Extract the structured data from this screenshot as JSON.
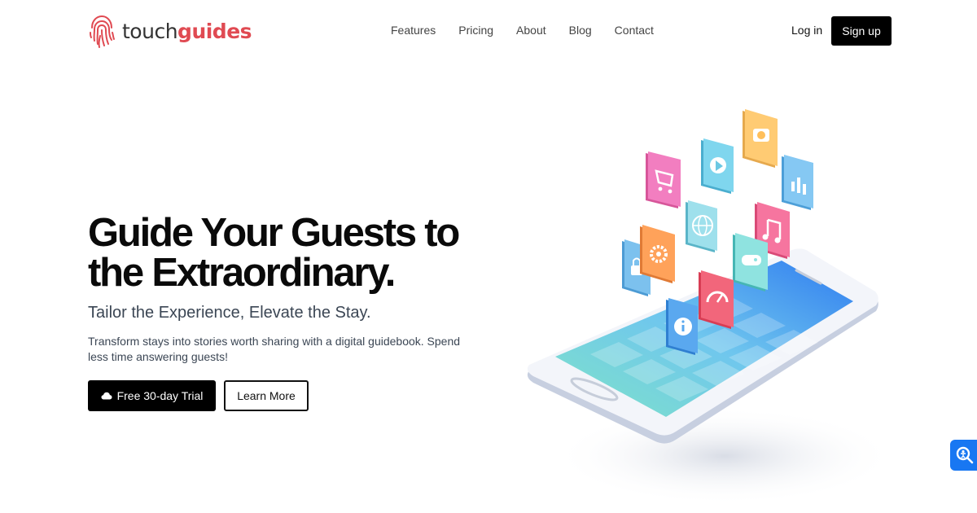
{
  "brand": {
    "name_part1": "touch",
    "name_part2": "guides",
    "brand_color": "#e04a52",
    "logo_icon": "fingerprint-icon"
  },
  "nav": {
    "links": [
      "Features",
      "Pricing",
      "About",
      "Blog",
      "Contact"
    ],
    "login_label": "Log in",
    "signup_label": "Sign up"
  },
  "hero": {
    "title": "Guide Your Guests to the Extraordinary.",
    "subtitle": "Tailor the Experience, Elevate the Stay.",
    "description": "Transform stays into stories worth sharing with a digital guidebook. Spend less time answering guests!",
    "primary_button": {
      "label": "Free 30-day Trial",
      "icon": "cloud-icon"
    },
    "secondary_button": {
      "label": "Learn More"
    }
  },
  "illustration": {
    "subject": "isometric smartphone with floating app icons",
    "app_icons": [
      "cart-icon",
      "play-icon",
      "camera-icon",
      "chart-icon",
      "globe-icon",
      "music-icon",
      "lock-icon",
      "gear-icon",
      "gamepad-icon",
      "speedometer-icon",
      "info-icon"
    ]
  },
  "widget": {
    "icon": "accessibility-search-icon",
    "color": "#1877f2"
  }
}
